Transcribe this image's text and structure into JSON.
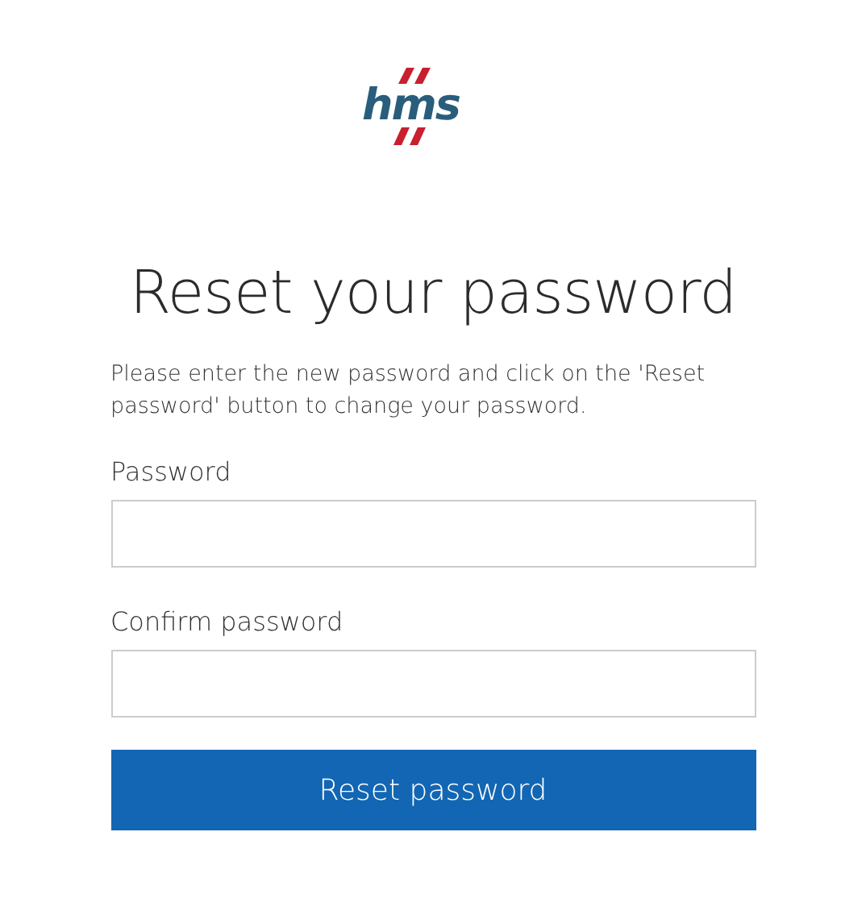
{
  "logo": {
    "text": "hms"
  },
  "title": "Reset your password",
  "instructions": "Please enter the new password and click on the 'Reset password' button to change your password.",
  "fields": [
    {
      "label": "Password"
    },
    {
      "label": "Confirm password"
    }
  ],
  "button": {
    "label": "Reset password"
  }
}
